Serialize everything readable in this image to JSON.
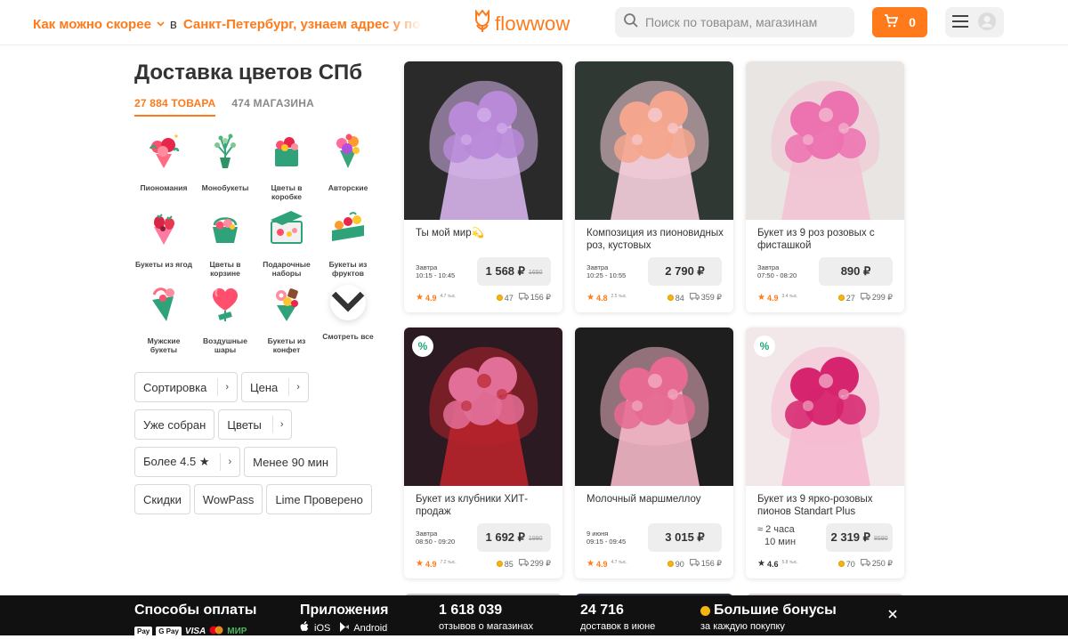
{
  "header": {
    "delivery_time": "Как можно скорее",
    "delivery_in": "в",
    "city": "Санкт-Петербург, узнаем адрес у получателя",
    "logo": "flowwow",
    "search_placeholder": "Поиск по товарам, магазинам",
    "cart_count": "0"
  },
  "page": {
    "title": "Доставка цветов СПб",
    "tabs": [
      {
        "label": "27 884 ТОВАРА",
        "active": true
      },
      {
        "label": "474 МАГАЗИНА",
        "active": false
      }
    ]
  },
  "categories": [
    {
      "label": "Пиономания",
      "icon": "peony-bouquet-icon"
    },
    {
      "label": "Монобукеты",
      "icon": "mono-bouquet-icon"
    },
    {
      "label": "Цветы в коробке",
      "icon": "flower-box-icon"
    },
    {
      "label": "Авторские",
      "icon": "author-bouquet-icon"
    },
    {
      "label": "Букеты из ягод",
      "icon": "berry-bouquet-icon"
    },
    {
      "label": "Цветы в корзине",
      "icon": "flower-basket-icon"
    },
    {
      "label": "Подарочные наборы",
      "icon": "gift-set-icon"
    },
    {
      "label": "Букеты из фруктов",
      "icon": "fruit-bouquet-icon"
    },
    {
      "label": "Мужские букеты",
      "icon": "mens-bouquet-icon"
    },
    {
      "label": "Воздушные шары",
      "icon": "balloons-icon"
    },
    {
      "label": "Букеты из конфет",
      "icon": "candy-bouquet-icon"
    },
    {
      "label": "Смотреть все",
      "icon": "chevron-down-icon"
    }
  ],
  "filters": [
    {
      "label": "Сортировка",
      "arrow": "›"
    },
    {
      "label": "Цена",
      "arrow": "›"
    },
    {
      "label": "Уже собран"
    },
    {
      "label": "Цветы",
      "arrow": "›"
    },
    {
      "label": "Более 4.5 ★",
      "arrow": "›"
    },
    {
      "label": "Менее 90 мин"
    },
    {
      "label": "Скидки"
    },
    {
      "label": "WowPass"
    },
    {
      "label": "Lime Проверено"
    }
  ],
  "products": [
    {
      "name": "Ты мой мир💫",
      "day": "Завтра",
      "time": "10:15 - 10:45",
      "price": "1 568 ₽",
      "old_price": "1650",
      "rating": "4.9",
      "reviews": "4.7 тыс.",
      "bonus": "47",
      "delivery_cost": "156 ₽",
      "discount_badge": "",
      "colors": {
        "bg": "#2a2a2a",
        "main": "#b98ad8",
        "accent": "#d7b4ec"
      }
    },
    {
      "name": "Композиция из пионовидных роз, кустовых",
      "day": "Завтра",
      "time": "10:25 - 10:55",
      "price": "2 790 ₽",
      "old_price": "",
      "rating": "4.8",
      "reviews": "2.5 тыс.",
      "bonus": "84",
      "delivery_cost": "359 ₽",
      "discount_badge": "",
      "colors": {
        "bg": "#2f3833",
        "main": "#f3a68d",
        "accent": "#f7d0dd"
      }
    },
    {
      "name": "Букет из 9 роз розовых с фисташкой",
      "day": "Завтра",
      "time": "07:50 - 08:20",
      "price": "890 ₽",
      "old_price": "",
      "rating": "4.9",
      "reviews": "3.4 тыс.",
      "bonus": "27",
      "delivery_cost": "299 ₽",
      "discount_badge": "",
      "colors": {
        "bg": "#e9e5e2",
        "main": "#ec72b0",
        "accent": "#f3c3d4"
      }
    },
    {
      "name": "Букет из клубники ХИТ-продаж",
      "day": "Завтра",
      "time": "08:50 - 09:20",
      "price": "1 692 ₽",
      "old_price": "1990",
      "rating": "4.9",
      "reviews": "7.2 тыс.",
      "bonus": "85",
      "delivery_cost": "299 ₽",
      "discount_badge": "%",
      "colors": {
        "bg": "#2b1a22",
        "main": "#e16f98",
        "accent": "#b8232b"
      }
    },
    {
      "name": "Молочный маршмеллоу",
      "day": "9 июня",
      "time": "09:15 - 09:45",
      "price": "3 015 ₽",
      "old_price": "",
      "rating": "4.9",
      "reviews": "4.7 тыс.",
      "bonus": "90",
      "delivery_cost": "156 ₽",
      "discount_badge": "",
      "colors": {
        "bg": "#1e1e1e",
        "main": "#e66a92",
        "accent": "#f4b7c8"
      }
    },
    {
      "name": "Букет из 9 ярко-розовых пионов Standart Plus",
      "day": "≈ 2 часа",
      "time": "10 мин",
      "price": "2 319 ₽",
      "old_price": "8590",
      "rating": "4.6",
      "reviews": "5.8 тыс.",
      "bonus": "70",
      "delivery_cost": "250 ₽",
      "discount_badge": "%",
      "colors": {
        "bg": "#f2e8ea",
        "main": "#d6246e",
        "accent": "#f5b9cf"
      }
    }
  ],
  "footer": {
    "payment_title": "Способы оплаты",
    "payment_methods": [
      "Pay",
      "G Pay",
      "VISA",
      "●●",
      "МИР"
    ],
    "apps_title": "Приложения",
    "ios": "iOS",
    "android": "Android",
    "reviews_count": "1 618 039",
    "reviews_label": "отзывов о магазинах",
    "june_count": "24 716",
    "june_label": "доставок в июне",
    "bonus_title": "Большие бонусы",
    "bonus_label": "за каждую покупку"
  }
}
